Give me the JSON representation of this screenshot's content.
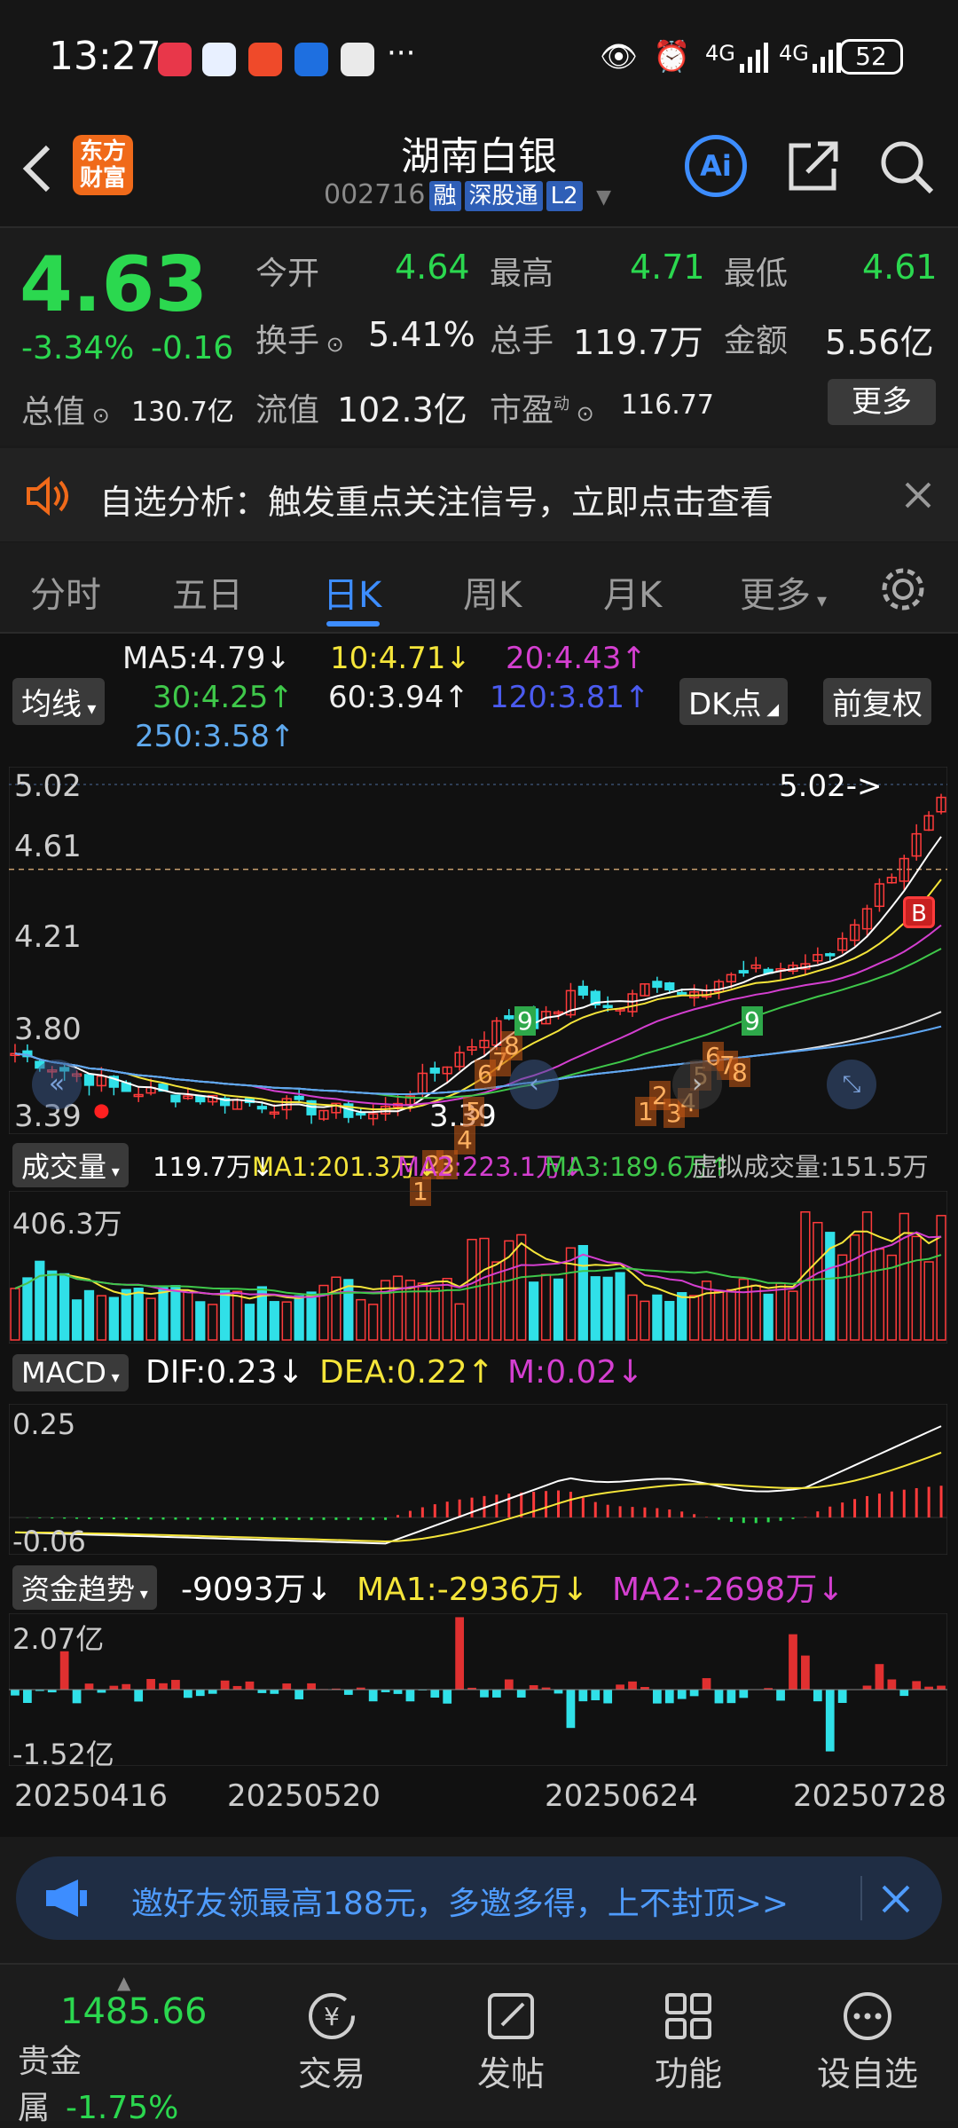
{
  "status": {
    "time": "13:27",
    "battery": "52",
    "net1": "4G",
    "net2": "4G",
    "dots": "···"
  },
  "header": {
    "logo_text_1": "东方",
    "logo_text_2": "财富",
    "stock_name": "湖南白银",
    "stock_code": "002716",
    "tags": [
      "融",
      "深股通",
      "L2"
    ]
  },
  "quote": {
    "price": "4.63",
    "change_pct": "-3.34%",
    "change": "-0.16",
    "open_label": "今开",
    "open": "4.64",
    "high_label": "最高",
    "high": "4.71",
    "low_label": "最低",
    "low": "4.61",
    "turnover_label": "换手",
    "turnover": "5.41%",
    "volume_label": "总手",
    "volume": "119.7万",
    "amount_label": "金额",
    "amount": "5.56亿",
    "mktcap_label": "总值",
    "mktcap": "130.7亿",
    "float_label": "流值",
    "float": "102.3亿",
    "pe_label": "市盈",
    "pe_sup": "动",
    "pe": "116.77",
    "more_button": "更多"
  },
  "alert": {
    "text": "自选分析：触发重点关注信号，立即点击查看"
  },
  "tabs": [
    "分时",
    "五日",
    "日K",
    "周K",
    "月K",
    "更多"
  ],
  "active_tab": "日K",
  "indicators": {
    "ma_selector": "均线",
    "ma5": "MA5:4.79↓",
    "ma10": "10:4.71↓",
    "ma20": "20:4.43↑",
    "ma30": "30:4.25↑",
    "ma60": "60:3.94↑",
    "ma120": "120:3.81↑",
    "ma250": "250:3.58↑",
    "dk_button": "DK点",
    "fq_button": "前复权"
  },
  "kline": {
    "y_top": "5.02",
    "y_mid": "4.61",
    "y_2": "4.21",
    "y_3": "3.80",
    "y_bottom": "3.39",
    "high_marker": "5.02->",
    "low_marker": "3.39",
    "b_signal": "B",
    "count_labels": [
      "1",
      "2",
      "3",
      "4",
      "5",
      "6",
      "7",
      "8",
      "9",
      "1",
      "2",
      "3",
      "4",
      "5",
      "6",
      "7",
      "8",
      "9"
    ]
  },
  "volume": {
    "selector": "成交量",
    "current": "119.7万↓",
    "ma1": "MA1:201.3万↓",
    "ma2": "MA2:223.1万↓",
    "ma3": "MA3:189.6万↑",
    "virtual": "虚拟成交量:151.5万",
    "y_top": "406.3万"
  },
  "macd": {
    "selector": "MACD",
    "dif": "DIF:0.23↓",
    "dea": "DEA:0.22↑",
    "m": "M:0.02↓",
    "y_top": "0.25",
    "y_bottom": "-0.06"
  },
  "fund": {
    "selector": "资金趋势",
    "current": "-9093万↓",
    "ma1": "MA1:-2936万↓",
    "ma2": "MA2:-2698万↓",
    "y_top": "2.07亿",
    "y_bottom": "-1.52亿"
  },
  "dates": [
    "20250416",
    "20250520",
    "20250624",
    "20250728"
  ],
  "invite": {
    "text": "邀好友领最高188元，多邀多得，上不封顶>>"
  },
  "nav": {
    "index_value": "1485.66",
    "index_name": "贵金属",
    "index_change": "-1.75%",
    "items": [
      "交易",
      "发帖",
      "功能",
      "设自选"
    ]
  },
  "colors": {
    "up": "#ff3b3b",
    "down": "#2bd84f",
    "accent": "#3d8dff",
    "ma5": "#ffffff",
    "ma10": "#f5e53a",
    "ma20": "#d43fd0",
    "ma30": "#3fc84a",
    "ma60": "#e0e0e0",
    "ma120": "#4b5bf0",
    "ma250": "#5fa9ee"
  }
}
